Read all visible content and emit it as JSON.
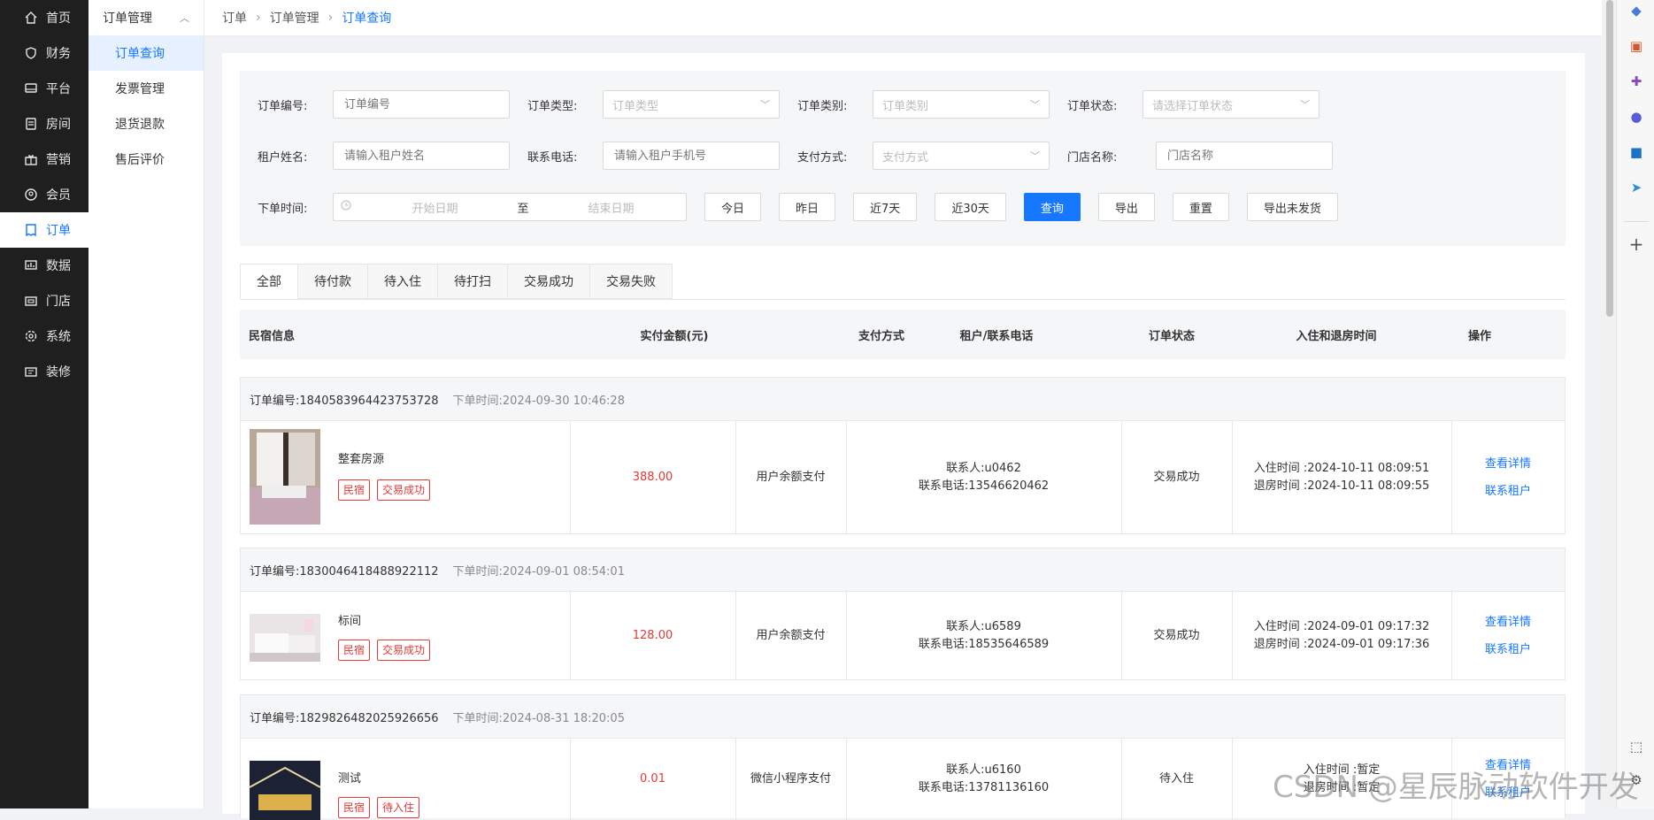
{
  "nav": {
    "items": [
      {
        "label": "首页",
        "icon": "home-icon"
      },
      {
        "label": "财务",
        "icon": "shield-icon"
      },
      {
        "label": "平台",
        "icon": "monitor-icon"
      },
      {
        "label": "房间",
        "icon": "document-icon"
      },
      {
        "label": "营销",
        "icon": "gift-icon"
      },
      {
        "label": "会员",
        "icon": "user-icon"
      },
      {
        "label": "订单",
        "icon": "order-icon"
      },
      {
        "label": "数据",
        "icon": "chart-icon"
      },
      {
        "label": "门店",
        "icon": "store-icon"
      },
      {
        "label": "系统",
        "icon": "gear-icon"
      },
      {
        "label": "装修",
        "icon": "decor-icon"
      }
    ],
    "active_index": 6
  },
  "submenu": {
    "title": "订单管理",
    "items": [
      {
        "label": "订单查询"
      },
      {
        "label": "发票管理"
      },
      {
        "label": "退货退款"
      },
      {
        "label": "售后评价"
      }
    ]
  },
  "breadcrumb": {
    "level1": "订单",
    "level2": "订单管理",
    "current": "订单查询"
  },
  "filters": {
    "order_no": {
      "label": "订单编号:",
      "placeholder": "订单编号"
    },
    "order_type": {
      "label": "订单类型:",
      "placeholder": "订单类型"
    },
    "order_category": {
      "label": "订单类别:",
      "placeholder": "订单类别"
    },
    "order_status": {
      "label": "订单状态:",
      "placeholder": "请选择订单状态"
    },
    "tenant_name": {
      "label": "租户姓名:",
      "placeholder": "请输入租户姓名"
    },
    "phone": {
      "label": "联系电话:",
      "placeholder": "请输入租户手机号"
    },
    "pay_method": {
      "label": "支付方式:",
      "placeholder": "支付方式"
    },
    "store_name": {
      "label": "门店名称:",
      "placeholder": "门店名称"
    },
    "order_time": {
      "label": "下单时间:",
      "start": "开始日期",
      "sep": "至",
      "end": "结束日期"
    },
    "buttons": {
      "today": "今日",
      "yesterday": "昨日",
      "last7": "近7天",
      "last30": "近30天",
      "query": "查询",
      "export": "导出",
      "reset": "重置",
      "export_unshipped": "导出未发货"
    }
  },
  "tabs": [
    "全部",
    "待付款",
    "待入住",
    "待打扫",
    "交易成功",
    "交易失败"
  ],
  "table_header": {
    "info": "民宿信息",
    "amount": "实付金额(元)",
    "pay": "支付方式",
    "tenant": "租户/联系电话",
    "status": "订单状态",
    "checkin": "入住和退房时间",
    "ops": "操作"
  },
  "orders": [
    {
      "no": "订单编号:1840583964423753728",
      "time": "下单时间:2024-09-30 10:46:28",
      "room": "整套房源",
      "tag1": "民宿",
      "tag2": "交易成功",
      "amount": "388.00",
      "pay": "用户余额支付",
      "contact": "联系人:u0462",
      "phone": "联系电话:13546620462",
      "status": "交易成功",
      "checkin": "入住时间 :2024-10-11 08:09:51",
      "checkout": "退房时间 :2024-10-11 08:09:55",
      "op1": "查看详情",
      "op2": "联系租户"
    },
    {
      "no": "订单编号:1830046418488922112",
      "time": "下单时间:2024-09-01 08:54:01",
      "room": "标间",
      "tag1": "民宿",
      "tag2": "交易成功",
      "amount": "128.00",
      "pay": "用户余额支付",
      "contact": "联系人:u6589",
      "phone": "联系电话:18535646589",
      "status": "交易成功",
      "checkin": "入住时间 :2024-09-01 09:17:32",
      "checkout": "退房时间 :2024-09-01 09:17:36",
      "op1": "查看详情",
      "op2": "联系租户"
    },
    {
      "no": "订单编号:1829826482025926656",
      "time": "下单时间:2024-08-31 18:20:05",
      "room": "测试",
      "tag1": "民宿",
      "tag2": "待入住",
      "amount": "0.01",
      "pay": "微信小程序支付",
      "contact": "联系人:u6160",
      "phone": "联系电话:13781136160",
      "status": "待入住",
      "checkin": "入住时间 :暂定",
      "checkout": "退房时间 :暂定",
      "op1": "查看详情",
      "op2": "联系租户"
    }
  ],
  "watermark": "CSDN @星辰脉动软件开发",
  "colors": {
    "accent": "#1677ff",
    "danger": "#e53935",
    "nav_bg": "#1f1f1f"
  }
}
